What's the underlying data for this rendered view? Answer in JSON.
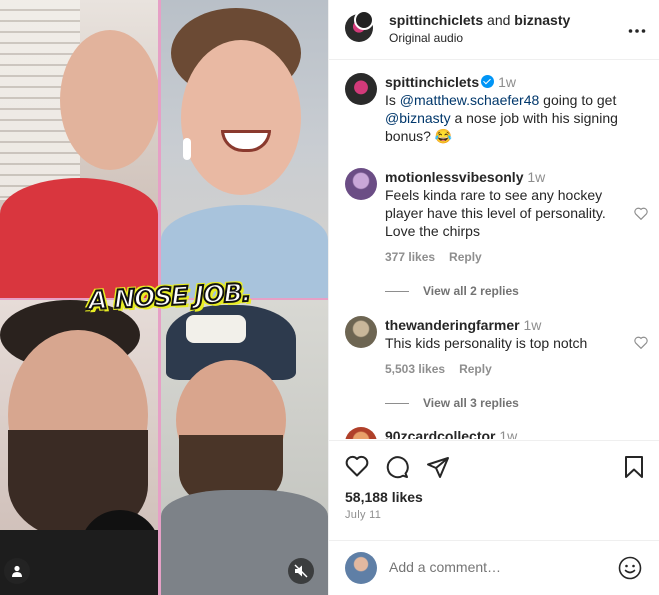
{
  "video": {
    "caption": "A NOSE JOB.",
    "person_button_icon": "person-icon",
    "mute_button_icon": "muted-speaker-icon"
  },
  "header": {
    "user1": "spittinchiclets",
    "joiner": "and",
    "user2": "biznasty",
    "audio": "Original audio",
    "more_icon": "more-horizontal-icon"
  },
  "caption_post": {
    "username": "spittinchiclets",
    "time": "1w",
    "text_prefix": "Is ",
    "mention1": "@matthew.schaefer48",
    "text_mid": " going to get ",
    "mention2": "@biznasty",
    "text_suffix": " a nose job with his signing bonus? 😂"
  },
  "comments": [
    {
      "username": "motionlessvibesonly",
      "time": "1w",
      "text": "Feels kinda rare to see any hockey player have this level of personality. Love the chirps",
      "likes": "377 likes",
      "reply": "Reply",
      "view_replies": "View all 2 replies"
    },
    {
      "username": "thewanderingfarmer",
      "time": "1w",
      "text": "This kids personality is top notch",
      "likes": "5,503 likes",
      "reply": "Reply",
      "view_replies": "View all 3 replies"
    },
    {
      "username": "90zcardcollector",
      "time": "1w"
    }
  ],
  "actions": {
    "likes": "58,188 likes",
    "date": "July 11"
  },
  "add_comment": {
    "placeholder": "Add a comment…"
  },
  "colors": {
    "accent_blue": "#0095f6",
    "mention": "#00376b",
    "muted": "#8e8e8e",
    "tile_divider": "#e6a0c6",
    "caption_outline": "#e8ed24"
  }
}
